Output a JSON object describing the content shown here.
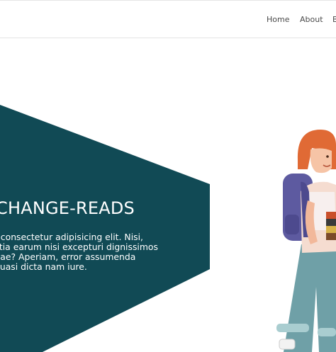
{
  "nav": {
    "links": [
      "Home",
      "About",
      "B"
    ]
  },
  "hero": {
    "title": "CHANGE-READS",
    "paragraph_lines": [
      "t consectetur adipisicing elit. Nisi,",
      "litia earum nisi excepturi dignissimos",
      "tiae? Aperiam, error assumenda",
      "quasi dicta nam iure."
    ],
    "colors": {
      "hexagon": "#114a55",
      "background": "#ffffff"
    }
  },
  "illustration": {
    "icon": "girl-reading-books-illustration"
  }
}
